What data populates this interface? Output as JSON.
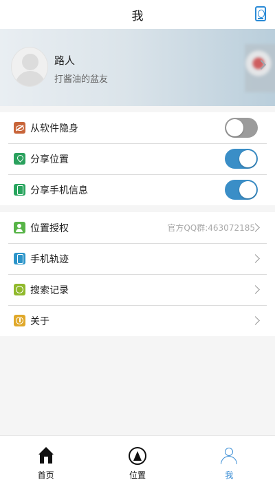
{
  "header": {
    "title": "我",
    "icon": "phone-search-icon"
  },
  "profile": {
    "name": "路人",
    "subtitle": "打酱油的盆友"
  },
  "settings": [
    {
      "label": "从软件隐身",
      "icon": "hide-icon",
      "enabled": false
    },
    {
      "label": "分享位置",
      "icon": "location-icon",
      "enabled": true
    },
    {
      "label": "分享手机信息",
      "icon": "phone-info-icon",
      "enabled": true
    }
  ],
  "menu": [
    {
      "label": "位置授权",
      "icon": "authorize-icon",
      "extra": "官方QQ群:463072185"
    },
    {
      "label": "手机轨迹",
      "icon": "track-icon",
      "extra": ""
    },
    {
      "label": "搜索记录",
      "icon": "search-record-icon",
      "extra": ""
    },
    {
      "label": "关于",
      "icon": "about-icon",
      "extra": ""
    }
  ],
  "tabs": [
    {
      "label": "首页",
      "icon": "home-icon",
      "active": false
    },
    {
      "label": "位置",
      "icon": "navigation-icon",
      "active": false
    },
    {
      "label": "我",
      "icon": "user-icon",
      "active": true
    }
  ],
  "colors": {
    "accent": "#3d8fd6",
    "toggle_on": "#3a8ec7",
    "toggle_off": "#9b9b9b"
  }
}
